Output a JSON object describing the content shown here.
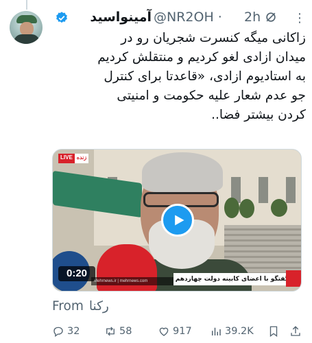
{
  "tweet": {
    "display_name": "آمینواسید",
    "handle": "@NR2OH",
    "separator": "·",
    "time": "2h",
    "text_lines": [
      "زاکانی میگه کنسرت شجریان رو در",
      "میدان ازادی لغو کردیم و منتقلش کردیم",
      "به استادیوم ازادی، «قاعدتا برای کنترل",
      "جو عدم شعار علیه حکومت و امنیتی",
      "کردن بیشتر فضا.."
    ],
    "from_label": "From",
    "from_source": "رکنا"
  },
  "media": {
    "live_badge_1": "LIVE",
    "live_badge_2": "زنده",
    "duration": "0:20",
    "lower_third": "گفتگو با اعضای کابینه دولت چهاردهم",
    "channel_strip": "Mehrnews.ir  |  mehrnews.com"
  },
  "stats": {
    "replies": "32",
    "reposts": "58",
    "likes": "917",
    "views": "39.2K"
  },
  "colors": {
    "accent": "#1d9bf0",
    "muted": "#536471",
    "text": "#0f1419"
  }
}
